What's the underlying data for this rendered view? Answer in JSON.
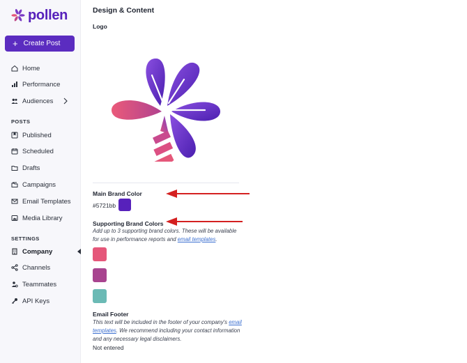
{
  "brand": {
    "name": "pollen",
    "color": "#5721bb"
  },
  "sidebar": {
    "create_label": "Create Post",
    "main_items": [
      {
        "label": "Home",
        "icon": "home-icon"
      },
      {
        "label": "Performance",
        "icon": "bar-chart-icon"
      },
      {
        "label": "Audiences",
        "icon": "users-icon"
      }
    ],
    "posts_header": "POSTS",
    "posts_items": [
      {
        "label": "Published",
        "icon": "bookmark-icon"
      },
      {
        "label": "Scheduled",
        "icon": "calendar-icon"
      },
      {
        "label": "Drafts",
        "icon": "folder-icon"
      },
      {
        "label": "Campaigns",
        "icon": "campaign-folder-icon"
      },
      {
        "label": "Email Templates",
        "icon": "mail-icon"
      },
      {
        "label": "Media Library",
        "icon": "image-icon"
      }
    ],
    "settings_header": "SETTINGS",
    "settings_items": [
      {
        "label": "Company",
        "icon": "building-icon",
        "active": true
      },
      {
        "label": "Channels",
        "icon": "share-icon"
      },
      {
        "label": "Teammates",
        "icon": "user-gear-icon"
      },
      {
        "label": "API Keys",
        "icon": "key-icon"
      }
    ]
  },
  "main": {
    "title": "Design & Content",
    "logo_label": "Logo",
    "main_color_label": "Main Brand Color",
    "main_color_hex": "#5721bb",
    "supporting_label": "Supporting Brand Colors",
    "supporting_help_1": "Add up to 3 supporting brand colors. These will be available for use in performance reports and ",
    "supporting_help_link": "email templates",
    "supporting_help_2": ".",
    "supporting_colors": [
      "#e5577a",
      "#a8448f",
      "#6bbab5"
    ],
    "footer_label": "Email Footer",
    "footer_help_1": "This text will be included in the footer of your company's ",
    "footer_help_link": "email templates",
    "footer_help_2": ". We recommend including your contact information and any necessary legal disclaimers.",
    "footer_value": "Not entered"
  },
  "annotations": {
    "arrow_color": "#d42020"
  }
}
